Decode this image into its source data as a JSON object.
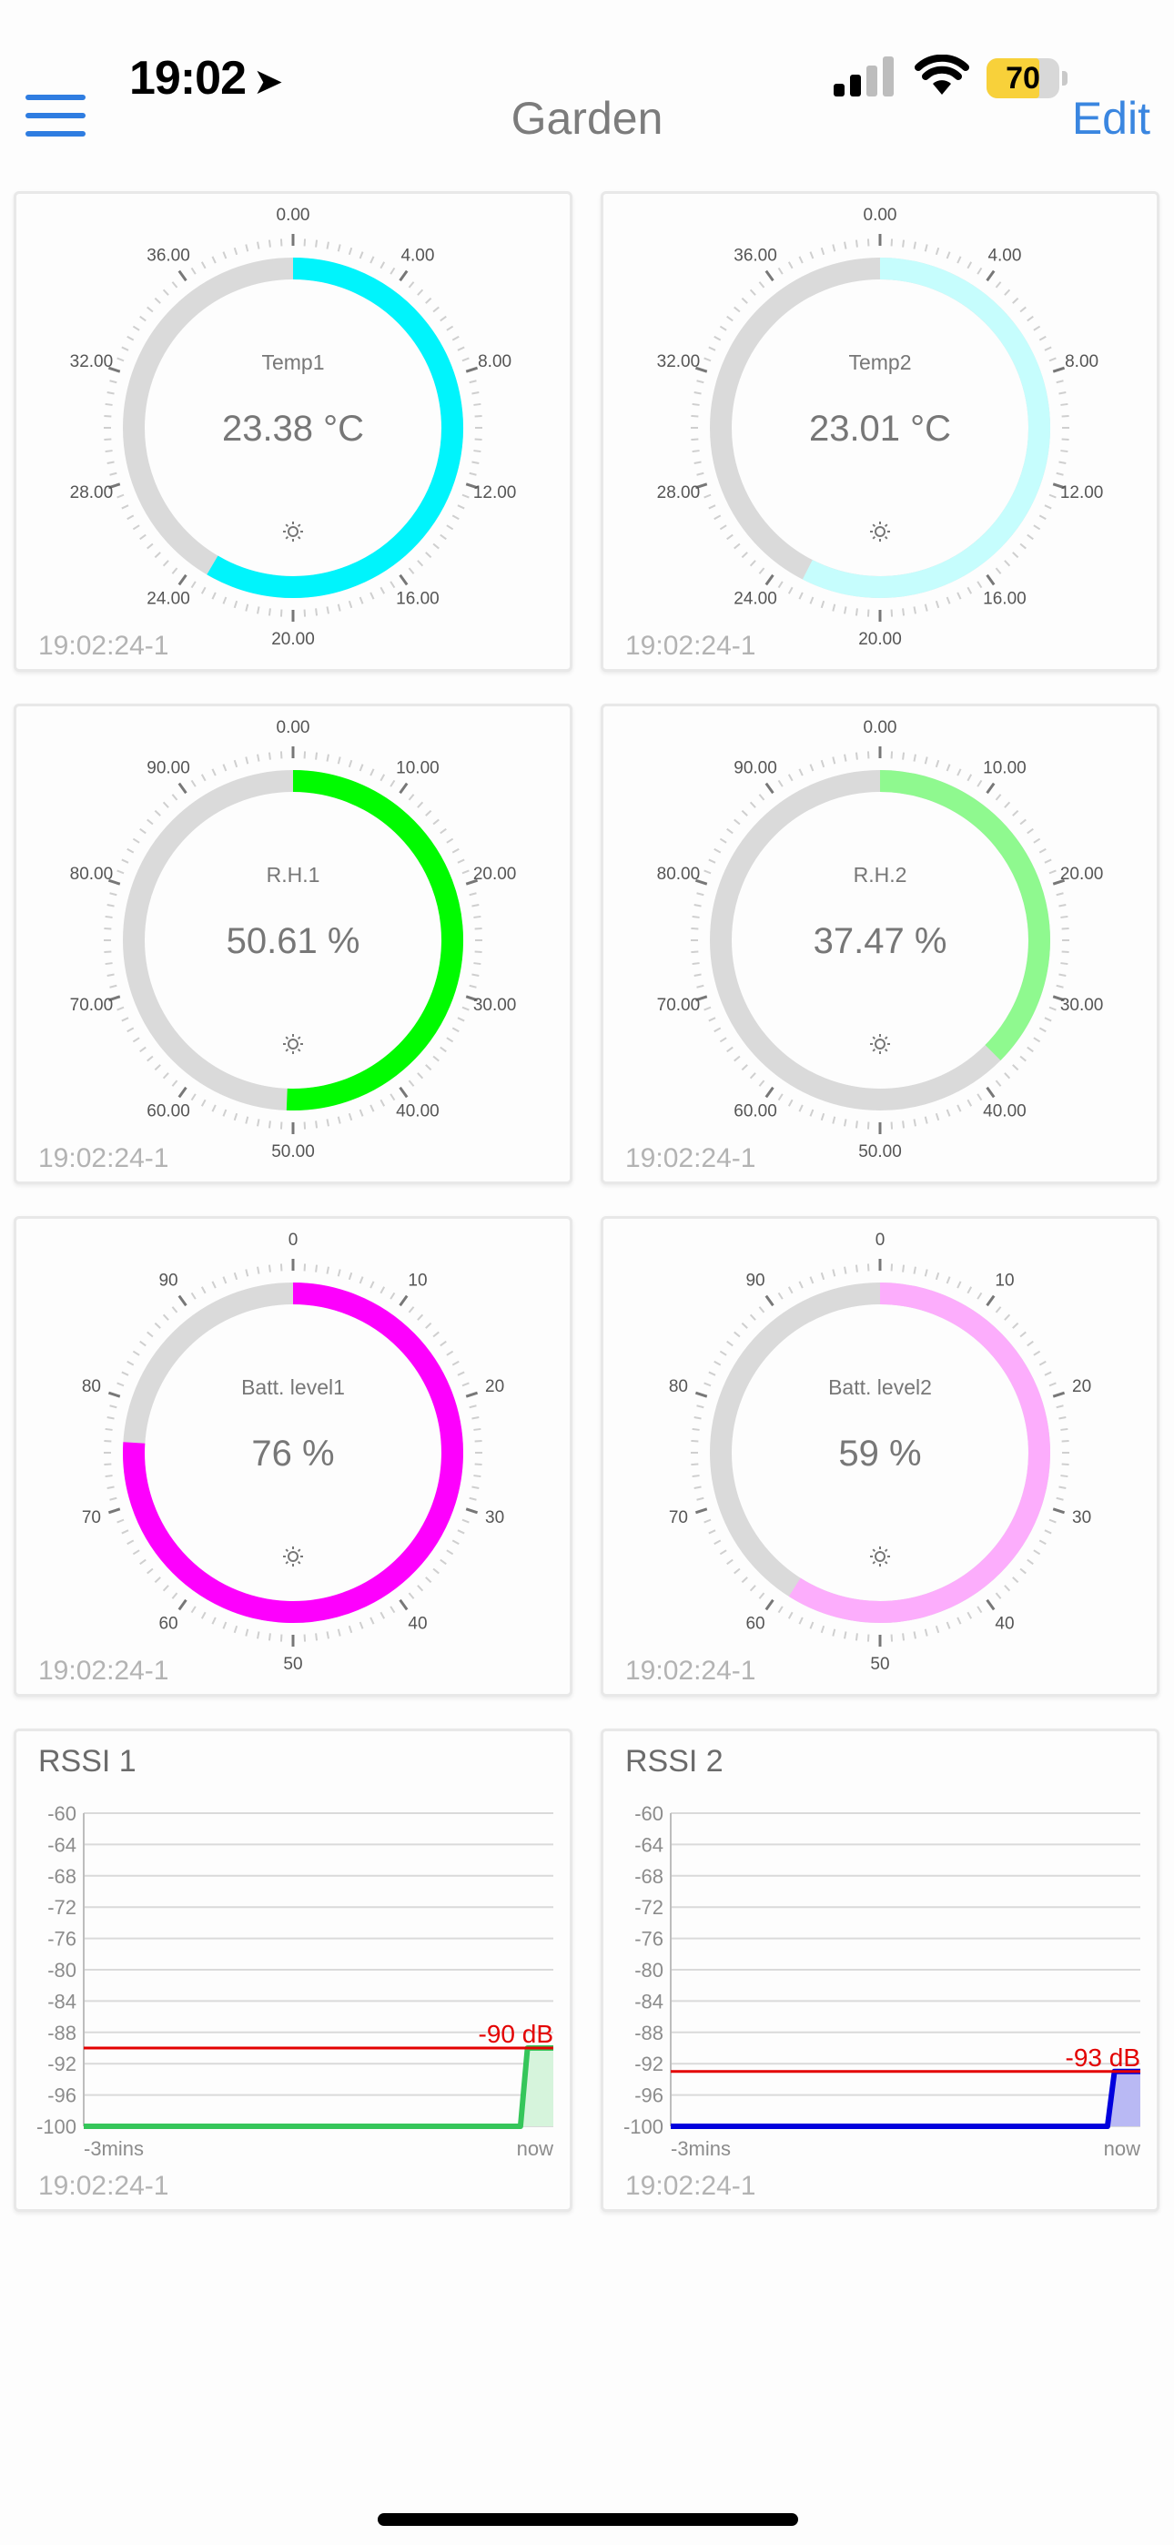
{
  "status": {
    "time": "19:02",
    "battery": "70"
  },
  "nav": {
    "title": "Garden",
    "edit": "Edit"
  },
  "gauges": [
    {
      "name": "temp1",
      "label": "Temp1",
      "value_text": "23.38 °C",
      "value": 23.38,
      "max": 40,
      "ticks": [
        "0.00",
        "4.00",
        "8.00",
        "12.00",
        "16.00",
        "20.00",
        "24.00",
        "28.00",
        "32.00",
        "36.00"
      ],
      "color": "#00f4fc",
      "timestamp": "19:02:24-1"
    },
    {
      "name": "temp2",
      "label": "Temp2",
      "value_text": "23.01 °C",
      "value": 23.01,
      "max": 40,
      "ticks": [
        "0.00",
        "4.00",
        "8.00",
        "12.00",
        "16.00",
        "20.00",
        "24.00",
        "28.00",
        "32.00",
        "36.00"
      ],
      "color": "#c6fdfd",
      "timestamp": "19:02:24-1"
    },
    {
      "name": "rh1",
      "label": "R.H.1",
      "value_text": "50.61 %",
      "value": 50.61,
      "max": 100,
      "ticks": [
        "0.00",
        "10.00",
        "20.00",
        "30.00",
        "40.00",
        "50.00",
        "60.00",
        "70.00",
        "80.00",
        "90.00"
      ],
      "color": "#00fb00",
      "timestamp": "19:02:24-1"
    },
    {
      "name": "rh2",
      "label": "R.H.2",
      "value_text": "37.47 %",
      "value": 37.47,
      "max": 100,
      "ticks": [
        "0.00",
        "10.00",
        "20.00",
        "30.00",
        "40.00",
        "50.00",
        "60.00",
        "70.00",
        "80.00",
        "90.00"
      ],
      "color": "#8ff98f",
      "timestamp": "19:02:24-1"
    },
    {
      "name": "batt1",
      "label": "Batt. level1",
      "value_text": "76 %",
      "value": 76,
      "max": 100,
      "ticks": [
        "0",
        "10",
        "20",
        "30",
        "40",
        "50",
        "60",
        "70",
        "80",
        "90"
      ],
      "color": "#fd00fd",
      "timestamp": "19:02:24-1"
    },
    {
      "name": "batt2",
      "label": "Batt. level2",
      "value_text": "59 %",
      "value": 59,
      "max": 100,
      "ticks": [
        "0",
        "10",
        "20",
        "30",
        "40",
        "50",
        "60",
        "70",
        "80",
        "90"
      ],
      "color": "#fcadfc",
      "timestamp": "19:02:24-1"
    }
  ],
  "chart_data": [
    {
      "type": "line",
      "title": "RSSI 1",
      "y_ticks": [
        "-60",
        "-64",
        "-68",
        "-72",
        "-76",
        "-80",
        "-84",
        "-88",
        "-92",
        "-96",
        "-100"
      ],
      "ylim": [
        -100,
        -60
      ],
      "x_labels": [
        "-3mins",
        "now"
      ],
      "series": [
        {
          "values": [
            -100,
            -100,
            -90,
            -90
          ],
          "color": "#35c65a",
          "fill": "#d6f4dc"
        }
      ],
      "threshold": {
        "value": -90,
        "label": "-90 dB",
        "color": "#e30000"
      },
      "timestamp": "19:02:24-1"
    },
    {
      "type": "line",
      "title": "RSSI 2",
      "y_ticks": [
        "-60",
        "-64",
        "-68",
        "-72",
        "-76",
        "-80",
        "-84",
        "-88",
        "-92",
        "-96",
        "-100"
      ],
      "ylim": [
        -100,
        -60
      ],
      "x_labels": [
        "-3mins",
        "now"
      ],
      "series": [
        {
          "values": [
            -100,
            -100,
            -93,
            -93
          ],
          "color": "#0000dd",
          "fill": "#b9b9f4"
        }
      ],
      "threshold": {
        "value": -93,
        "label": "-93 dB",
        "color": "#e30000"
      },
      "timestamp": "19:02:24-1"
    }
  ]
}
